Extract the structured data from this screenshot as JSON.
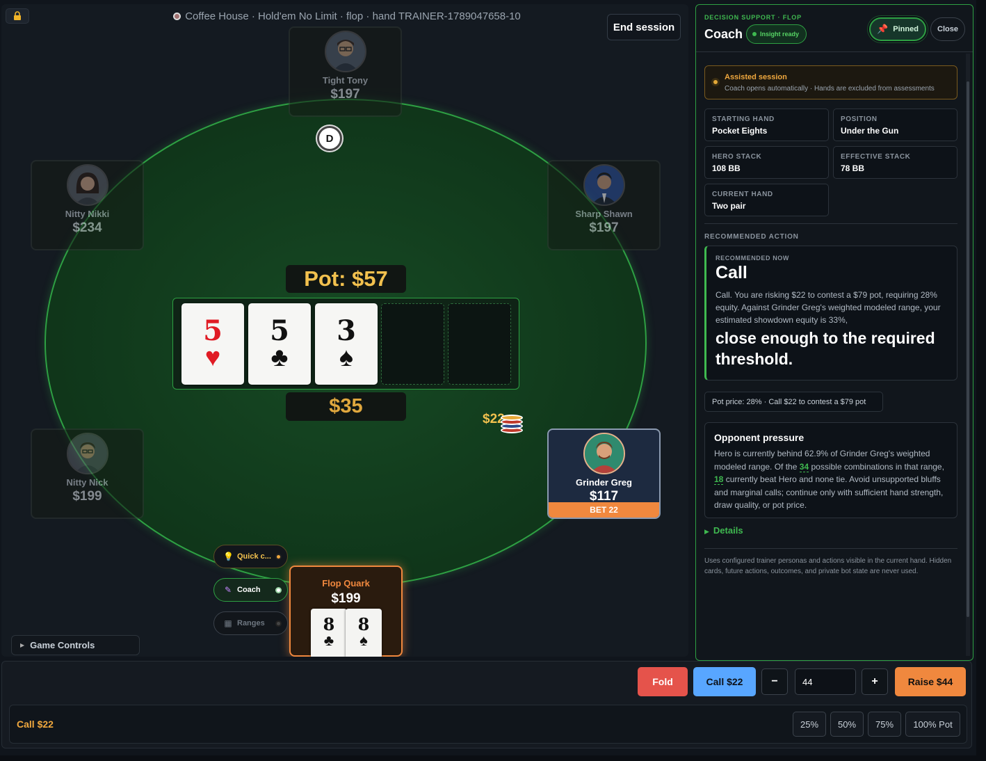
{
  "header": {
    "table_info": "Coffee House · Hold'em No Limit · flop · hand TRAINER-1789047658-10",
    "end_session": "End session"
  },
  "players": {
    "top": {
      "name": "Tight Tony",
      "stack": "$197"
    },
    "upper_left": {
      "name": "Nitty Nikki",
      "stack": "$234"
    },
    "upper_right": {
      "name": "Sharp Shawn",
      "stack": "$197"
    },
    "lower_left": {
      "name": "Nitty Nick",
      "stack": "$199"
    },
    "active": {
      "name": "Grinder Greg",
      "stack": "$117",
      "bet_tag": "BET 22"
    },
    "hero": {
      "name": "Flop Quark",
      "stack": "$199",
      "cards": [
        {
          "rank": "8",
          "suit": "♣"
        },
        {
          "rank": "8",
          "suit": "♠"
        }
      ]
    }
  },
  "dealer_button": "D",
  "pot": {
    "label": "Pot: $57",
    "side": "$35",
    "bet_chip": "$22"
  },
  "board": [
    {
      "rank": "5",
      "suit": "♥",
      "color": "#e01b24"
    },
    {
      "rank": "5",
      "suit": "♣",
      "color": "#111111"
    },
    {
      "rank": "3",
      "suit": "♠",
      "color": "#111111"
    }
  ],
  "tools": {
    "quick": "Quick c...",
    "coach": "Coach",
    "ranges": "Ranges"
  },
  "game_controls": "Game Controls",
  "coach": {
    "kicker": "DECISION SUPPORT · FLOP",
    "title": "Coach",
    "insight": "Insight ready",
    "pinned": "Pinned",
    "close": "Close",
    "assist_title": "Assisted session",
    "assist_sub": "Coach opens automatically · Hands are excluded from assessments",
    "stats": [
      {
        "label": "STARTING HAND",
        "value": "Pocket Eights"
      },
      {
        "label": "POSITION",
        "value": "Under the Gun"
      },
      {
        "label": "HERO STACK",
        "value": "108 BB"
      },
      {
        "label": "EFFECTIVE STACK",
        "value": "78 BB"
      },
      {
        "label": "CURRENT HAND",
        "value": "Two pair"
      }
    ],
    "section": "RECOMMENDED ACTION",
    "rec_kicker": "RECOMMENDED NOW",
    "rec_action": "Call",
    "rec_text": "Call. You are risking $22 to contest a $79 pot, requiring 28% equity. Against Grinder Greg's weighted modeled range, your estimated showdown equity is 33%,",
    "rec_big": "close enough to the required threshold.",
    "pot_price": "Pot price: 28% · Call $22 to contest a $79 pot",
    "opp_title": "Opponent pressure",
    "opp_text_1": "Hero is currently behind 62.9% of Grinder Greg's weighted modeled range. Of the",
    "opp_num_1": "34",
    "opp_text_2": "possible combinations in that range,",
    "opp_num_2": "18",
    "opp_text_3": "currently beat Hero and none tie. Avoid unsupported bluffs and marginal calls; continue only with sufficient hand strength, draw quality, or pot price.",
    "details": "Details",
    "footnote": "Uses configured trainer personas and actions visible in the current hand. Hidden cards, future actions, outcomes, and private bot state are never used."
  },
  "actions": {
    "fold": "Fold",
    "call": "Call $22",
    "minus": "−",
    "amount": "44",
    "plus": "+",
    "raise": "Raise $44",
    "status": "Call $22",
    "presets": [
      "25%",
      "50%",
      "75%",
      "100% Pot"
    ]
  }
}
